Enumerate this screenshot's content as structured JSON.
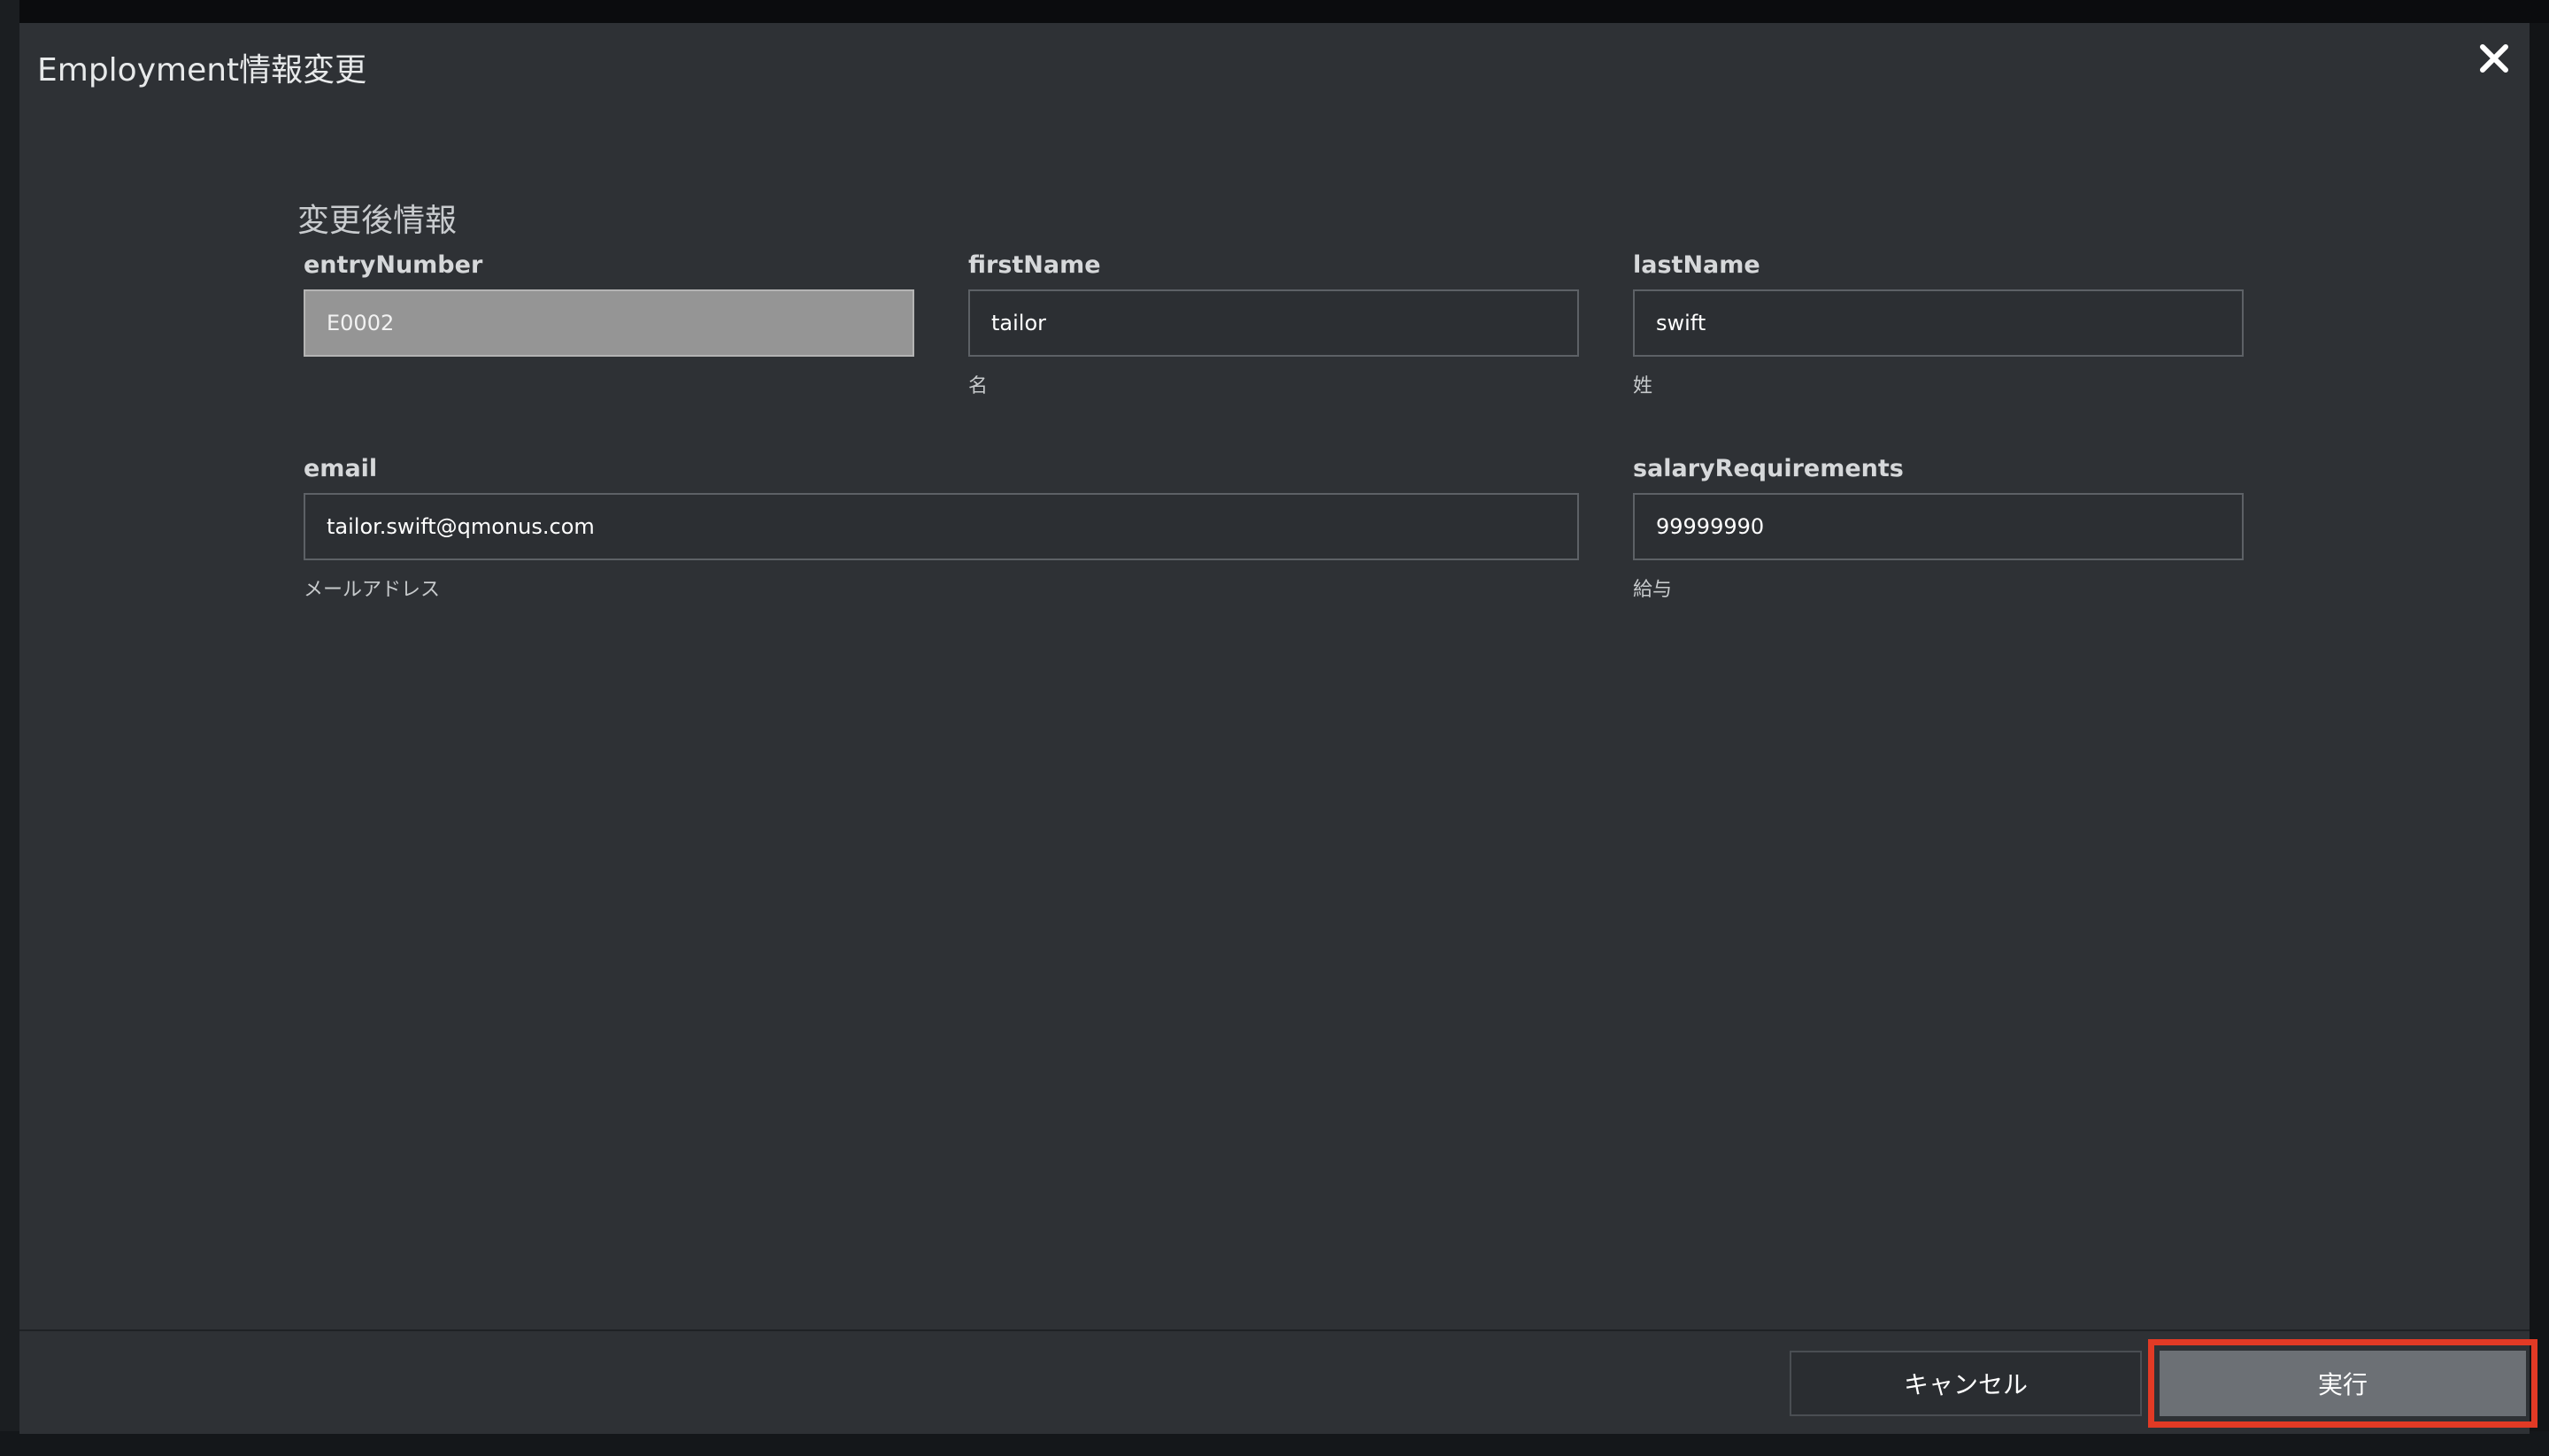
{
  "modal": {
    "title": "Employment情報変更",
    "close_icon": "close-icon"
  },
  "form": {
    "section_heading": "変更後情報",
    "fields": {
      "entryNumber": {
        "label": "entryNumber",
        "value": "E0002",
        "hint": "",
        "readonly": true
      },
      "firstName": {
        "label": "firstName",
        "value": "tailor",
        "hint": "名"
      },
      "lastName": {
        "label": "lastName",
        "value": "swift",
        "hint": "姓"
      },
      "email": {
        "label": "email",
        "value": "tailor.swift@qmonus.com",
        "hint": "メールアドレス"
      },
      "salaryRequirements": {
        "label": "salaryRequirements",
        "value": "99999990",
        "hint": "給与"
      }
    }
  },
  "footer": {
    "cancel_label": "キャンセル",
    "execute_label": "実行"
  },
  "colors": {
    "modal_bg": "#2e3135",
    "readonly_input_bg": "#959595",
    "execute_button_bg": "#6c7075",
    "highlight": "#e23a25"
  }
}
